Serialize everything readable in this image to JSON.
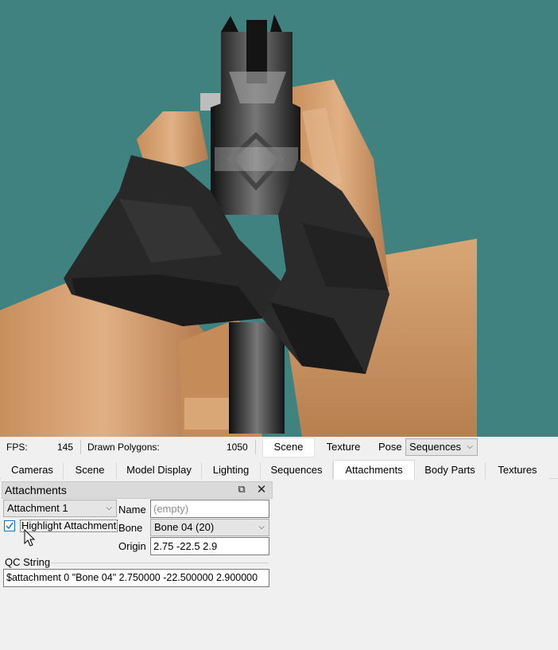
{
  "statusbar": {
    "fps_label": "FPS:",
    "fps_value": "145",
    "polygons_label": "Drawn Polygons:",
    "polygons_value": "1050",
    "view_tabs": [
      "Scene",
      "Texture"
    ],
    "active_view_tab": "Scene",
    "pose_label": "Pose",
    "pose_value": "Sequences"
  },
  "tabs": [
    "Cameras",
    "Scene",
    "Model Display",
    "Lighting",
    "Sequences",
    "Attachments",
    "Body Parts",
    "Textures"
  ],
  "active_tab": "Attachments",
  "dock": {
    "title": "Attachments",
    "attachment_select": "Attachment 1",
    "highlight_label": "Highlight Attachment",
    "highlight_checked": true,
    "name_label": "Name",
    "name_placeholder": "(empty)",
    "name_value": "",
    "bone_label": "Bone",
    "bone_value": "Bone 04 (20)",
    "origin_label": "Origin",
    "origin_value": "2.75 -22.5 2.9",
    "qc_label": "QC String",
    "qc_value": "$attachment 0 \"Bone 04\" 2.750000 -22.500000 2.900000"
  },
  "colors": {
    "viewport_bg": "#3f8280",
    "skin": "#d09a6a",
    "glove": "#2a2a2a",
    "gun": "#1e1e1e"
  }
}
